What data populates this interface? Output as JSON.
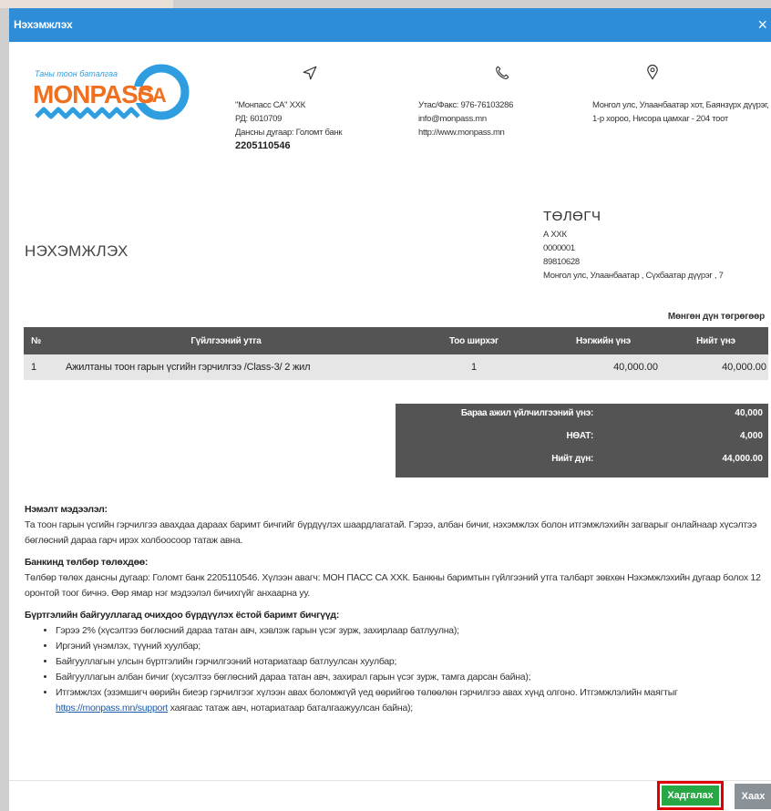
{
  "modal": {
    "title": "Нэхэмжлэх",
    "close_glyph": "×"
  },
  "logo": {
    "tagline": "Таны тоон баталгаа",
    "brand": "MONPASS",
    "suffix": "CA"
  },
  "company": {
    "name": "\"Монпасс СА\" ХХК",
    "reg": "РД: 6010709",
    "account_label": "Дансны дугаар: Голомт банк",
    "account_number": "2205110546"
  },
  "contact": {
    "phone": "Утас/Факс: 976-76103286",
    "email": "info@monpass.mn",
    "web": "http://www.monpass.mn"
  },
  "address": {
    "line": "Монгол улс, Улаанбаатар хот, Баянзүрх дүүрэг, 1-р хороо, Нисора цамхаг - 204 тоот"
  },
  "invoice_title": "НЭХЭМЖЛЭХ",
  "payer": {
    "heading": "ТӨЛӨГЧ",
    "name": "А ХХК",
    "code": "0000001",
    "phone": "89810628",
    "address": "Монгол улс, Улаанбаатар , Сүхбаатар дүүрэг , 7"
  },
  "currency_note": "Мөнгөн дүн төгрөгөөр",
  "table": {
    "headers": [
      "№",
      "Гүйлгээний утга",
      "Тоо ширхэг",
      "Нэгжийн үнэ",
      "Нийт үнэ"
    ],
    "rows": [
      [
        "1",
        "Ажилтаны тоон гарын үсгийн гэрчилгээ /Class-3/ 2 жил",
        "1",
        "40,000.00",
        "40,000.00"
      ]
    ]
  },
  "summary": {
    "subtotal_label": "Бараа ажил үйлчилгээний үнэ:",
    "subtotal_value": "40,000",
    "vat_label": "НӨАТ:",
    "vat_value": "4,000",
    "total_label": "Нийт дүн:",
    "total_value": "44,000.00"
  },
  "notes": {
    "extra_heading": "Нэмэлт мэдээлэл:",
    "extra_text": "Та тоон гарын үсгийн гэрчилгээ авахдаа дараах баримт бичгийг бүрдүүлэх шаардлагатай. Гэрээ, албан бичиг, нэхэмжлэх болон итгэмжлэхийн загварыг онлайнаар хүсэлтээ бөглөсний дараа гарч ирэх холбоосоор татаж авна.",
    "bank_heading": "Банкинд төлбөр төлөхдөө:",
    "bank_text": "Төлбөр төлөх дансны дугаар: Голомт банк 2205110546. Хүлээн авагч: МОН ПАСС СА ХХК. Банкны баримтын гүйлгээний утга талбарт зөвхөн Нэхэмжлэхийн дугаар болох 12 оронтой тоог бичнэ. Өөр ямар нэг мэдээлэл бичихгүйг анхаарна уу.",
    "docs_heading": "Бүртгэлийн байгууллагад очихдоо бүрдүүлэх ёстой баримт бичгүүд:",
    "docs": [
      "Гэрээ 2% (хүсэлтээ бөглөсний дараа татан авч, хэвлэж гарын үсэг зурж, захирлаар батлуулна);",
      "Иргэний үнэмлэх, түүний хуулбар;",
      "Байгууллагын улсын бүртгэлийн гэрчилгээний нотариатаар батлуулсан хуулбар;",
      "Байгууллагын албан бичиг (хүсэлтээ бөглөсний дараа татан авч, захирал гарын үсэг зурж, тамга дарсан байна);"
    ],
    "doc5_text": "Итгэмжлэх (эзэмшигч өөрийн биеэр гэрчилгээг хүлээн авах боломжгүй үед өөрийгөө төлөөлөн гэрчилгээ авах хүнд олгоно. Итгэмжлэлийн маягтыг ",
    "doc5_link": "https://monpass.mn/support",
    "doc5_tail": " хаягаас татаж авч, нотариатаар баталгаажуулсан байна);"
  },
  "buttons": {
    "save": "Хадгалах",
    "close": "Хаах"
  },
  "colors": {
    "header": "#2f8dd8",
    "save": "#28a745",
    "highlight": "#e00000",
    "close": "#8a9297",
    "table_dark": "#545454"
  }
}
